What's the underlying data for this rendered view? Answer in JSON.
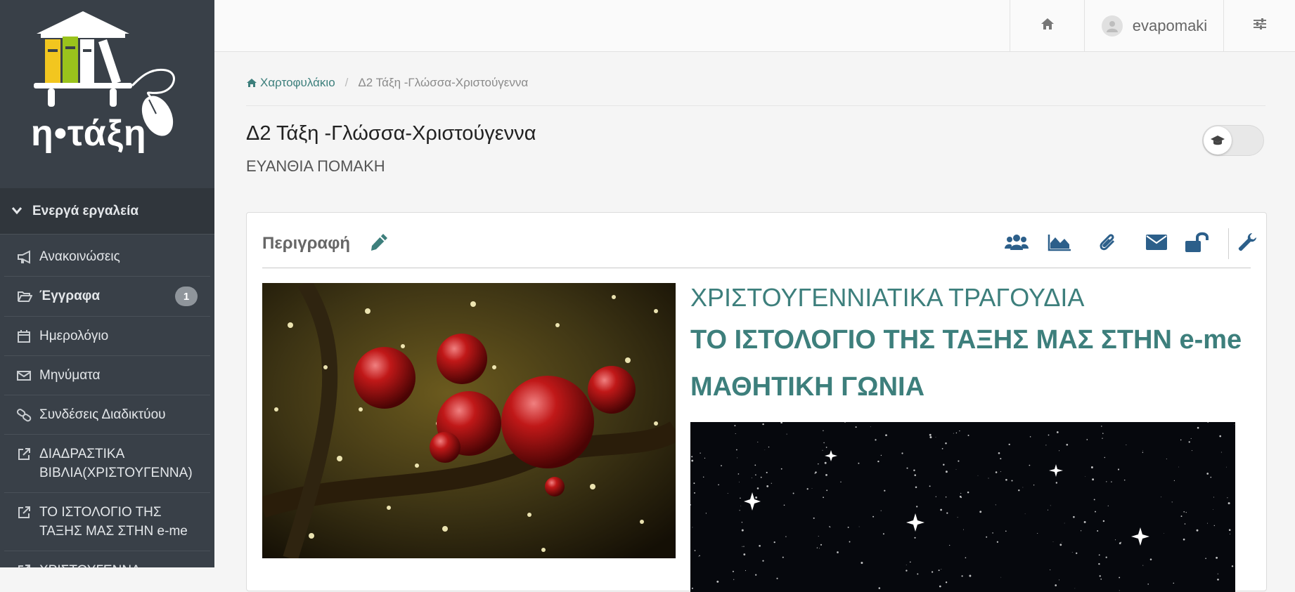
{
  "app": {
    "logo_text": "η•τάξη"
  },
  "sidebar": {
    "tools_header": "Ενεργά εργαλεία",
    "items": [
      {
        "label": "Ανακοινώσεις",
        "icon": "megaphone-icon"
      },
      {
        "label": "Έγγραφα",
        "icon": "folder-open-icon",
        "badge": "1"
      },
      {
        "label": "Ημερολόγιο",
        "icon": "calendar-icon"
      },
      {
        "label": "Μηνύματα",
        "icon": "envelope-icon"
      },
      {
        "label": "Συνδέσεις Διαδικτύου",
        "icon": "link-icon"
      },
      {
        "label": "ΔΙΑΔΡΑΣΤΙΚΑ ΒΙΒΛΙΑ(ΧΡΙΣΤΟΥΓΕΝΝΑ)",
        "icon": "external-link-icon"
      },
      {
        "label": "ΤΟ ΙΣΤΟΛΟΓΙΟ ΤΗΣ ΤΑΞΗΣ ΜΑΣ ΣΤΗΝ e-me",
        "icon": "external-link-icon"
      },
      {
        "label": "ΧΡΙΣΤΟΥΓΕΝΝΑ-",
        "icon": "external-link-icon"
      }
    ]
  },
  "topbar": {
    "username": "evapomaki"
  },
  "breadcrumb": {
    "root": "Χαρτοφυλάκιο",
    "current": "Δ2 Τάξη -Γλώσσα-Χριστούγεννα"
  },
  "page": {
    "title": "Δ2 Τάξη -Γλώσσα-Χριστούγεννα",
    "subtitle": "ΕΥΑΝΘΙΑ ΠΟΜΑΚΗ"
  },
  "panel": {
    "title": "Περιγραφή",
    "heading_songs": "ΧΡΙΣΤΟΥΓΕΝΝΙΑΤΙΚΑ ΤΡΑΓΟΥΔΙΑ",
    "heading_blog": "ΤΟ ΙΣΤΟΛΟΓΙΟ ΤΗΣ ΤΑΞΗΣ ΜΑΣ ΣΤΗΝ e-me",
    "heading_corner": "ΜΑΘΗΤΙΚΗ ΓΩΝΙΑ"
  },
  "colors": {
    "accent": "#3d7f7c",
    "tool_icon": "#2c5f8a",
    "sidebar_bg": "#394048"
  }
}
